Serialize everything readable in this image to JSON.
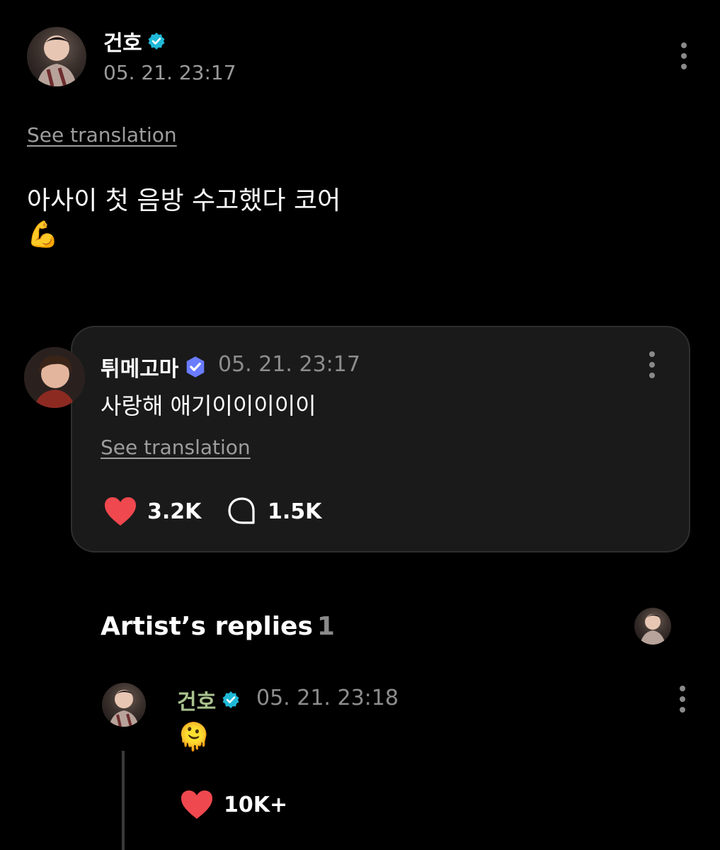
{
  "post": {
    "author": "건호",
    "date": "05. 21. 23:17",
    "see_translation": "See translation",
    "body_line1": "아사이 첫 음방 수고했다 코어",
    "body_emoji": "💪"
  },
  "comment": {
    "author": "튀메고마",
    "date": "05. 21. 23:17",
    "text": "사랑해 애기이이이이이",
    "see_translation": "See translation",
    "likes": "3.2K",
    "replies": "1.5K"
  },
  "artist_replies": {
    "title": "Artist’s replies",
    "count": "1",
    "reply": {
      "author": "건호",
      "date": "05. 21. 23:18",
      "emoji": "🫠",
      "likes": "10K+"
    }
  },
  "colors": {
    "background": "#000000",
    "card": "#1a1a1a",
    "heart": "#f0484f",
    "verified_artist": "#1fb8d6",
    "verified_fan": "#6a7cff",
    "reply_name": "#a9c28e"
  }
}
